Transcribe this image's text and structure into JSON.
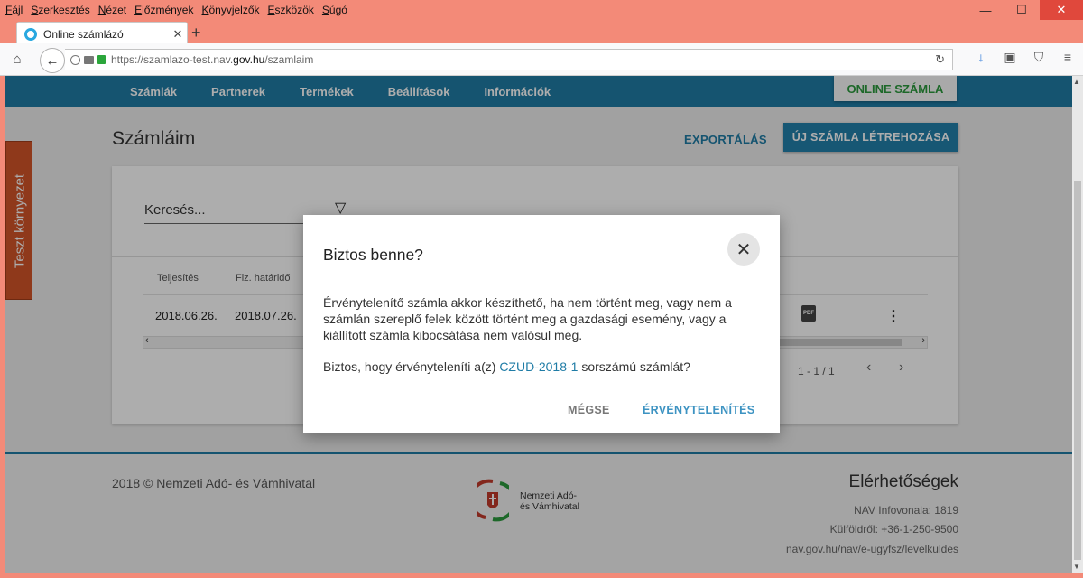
{
  "menubar": {
    "items": [
      {
        "mnemonic": "F",
        "rest": "ájl"
      },
      {
        "mnemonic": "S",
        "rest": "zerkesztés"
      },
      {
        "mnemonic": "N",
        "rest": "ézet"
      },
      {
        "mnemonic": "E",
        "rest": "lőzmények"
      },
      {
        "mnemonic": "K",
        "rest": "önyvjelzők"
      },
      {
        "mnemonic": "E",
        "rest": "szközök"
      },
      {
        "mnemonic": "S",
        "rest": "úgó"
      }
    ]
  },
  "window_controls": {
    "minimize": "—",
    "maximize": "☐",
    "close": "✕"
  },
  "tab": {
    "title": "Online számlázó",
    "close": "✕",
    "new_tab": "+"
  },
  "url": {
    "prefix": "https://szamlazo-test.nav.",
    "domain": "gov.hu",
    "suffix": "/szamlaim"
  },
  "app_nav": {
    "items": [
      "Számlák",
      "Partnerek",
      "Termékek",
      "Beállítások",
      "Információk"
    ],
    "online_button": "ONLINE SZÁMLA"
  },
  "side_tab": "Teszt környezet",
  "page": {
    "title": "Számláim",
    "export": "EXPORTÁLÁS",
    "new_invoice": "ÚJ SZÁMLA LÉTREHOZÁSA",
    "search_placeholder": "Keresés..."
  },
  "table": {
    "headers": [
      "Teljesítés",
      "Fiz. határidő"
    ],
    "rows": [
      {
        "fulfillment": "2018.06.26.",
        "due": "2018.07.26."
      }
    ],
    "pager": "1 - 1 / 1"
  },
  "footer": {
    "copyright": "2018 © Nemzeti Adó- és Vámhivatal",
    "logo_line1": "Nemzeti Adó-",
    "logo_line2": "és Vámhivatal",
    "contact_title": "Elérhetőségek",
    "contact_lines": [
      "NAV Infovonala: 1819",
      "Külföldről: +36-1-250-9500",
      "nav.gov.hu/nav/e-ugyfsz/levelkuldes"
    ]
  },
  "dialog": {
    "title": "Biztos benne?",
    "body": "Érvénytelenítő számla akkor készíthető, ha nem történt meg, vagy nem a számlán szereplő felek között történt meg a gazdasági esemény, vagy a kiállított számla kibocsátása nem valósul meg.",
    "question_before": "Biztos, hogy érvényteleníti a(z) ",
    "invoice_number": "CZUD-2018-1",
    "question_after": " sorszámú számlát?",
    "cancel": "MÉGSE",
    "confirm": "ÉRVÉNYTELENÍTÉS"
  },
  "colors": {
    "accent": "#1f7ca6",
    "online_green": "#2c9a3d",
    "side_tab": "#d35428",
    "window_frame": "#f38a78"
  }
}
